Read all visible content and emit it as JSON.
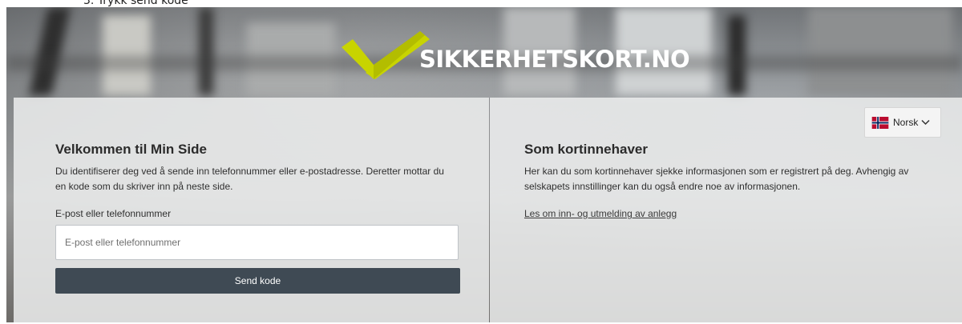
{
  "caption": {
    "text": "3. Trykk send kode"
  },
  "header": {
    "logo_text": "SIKKERHETSKORT.NO"
  },
  "login_panel": {
    "title": "Velkommen til Min Side",
    "description": "Du identifiserer deg ved å sende inn telefonnummer eller e-postadresse. Deretter mottar du en kode som du skriver inn på neste side.",
    "field_label": "E-post eller telefonnummer",
    "input_value": "",
    "input_placeholder": "E-post eller telefonnummer",
    "submit_label": "Send kode"
  },
  "info_panel": {
    "title": "Som kortinnehaver",
    "description": "Her kan du som kortinnehaver sjekke informasjonen som er registrert på deg. Avhengig av selskapets innstillinger kan du også endre noe av informasjonen.",
    "link_text": "Les om inn- og utmelding av anlegg"
  },
  "language": {
    "selected": "Norsk",
    "icon": "norway-flag-icon"
  },
  "colors": {
    "logo_accent": "#c8d400",
    "button_bg": "#3f4a54",
    "panel_bg": "#ecedee"
  }
}
